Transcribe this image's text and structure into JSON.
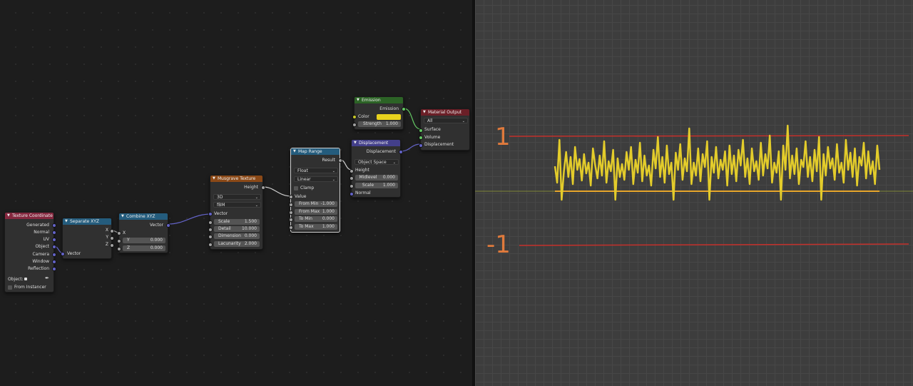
{
  "node_editor": {
    "nodes": {
      "texture_coordinate": {
        "title": "Texture Coordinate",
        "outputs": [
          "Generated",
          "Normal",
          "UV",
          "Object",
          "Camera",
          "Window",
          "Reflection"
        ],
        "object_label": "Object:",
        "from_instancer": "From Instancer"
      },
      "separate_xyz": {
        "title": "Separate XYZ",
        "outputs": [
          "X",
          "Y",
          "Z"
        ],
        "input": "Vector"
      },
      "combine_xyz": {
        "title": "Combine XYZ",
        "output": "Vector",
        "input_x": "X",
        "y_label": "Y",
        "y_value": "0.000",
        "z_label": "Z",
        "z_value": "0.000"
      },
      "musgrave": {
        "title": "Musgrave Texture",
        "output": "Height",
        "dimension_mode": "3D",
        "type": "fBM",
        "input_vector": "Vector",
        "fields": [
          {
            "label": "Scale",
            "value": "1.500"
          },
          {
            "label": "Detail",
            "value": "10.000"
          },
          {
            "label": "Dimension",
            "value": "0.000"
          },
          {
            "label": "Lacunarity",
            "value": "2.000"
          }
        ]
      },
      "map_range": {
        "title": "Map Range",
        "output": "Result",
        "data_type": "Float",
        "interpolation": "Linear",
        "clamp": "Clamp",
        "input_value": "Value",
        "fields": [
          {
            "label": "From Min",
            "value": "-1.000"
          },
          {
            "label": "From Max",
            "value": "1.000"
          },
          {
            "label": "To Min",
            "value": "0.000"
          },
          {
            "label": "To Max",
            "value": "1.000"
          }
        ]
      },
      "emission": {
        "title": "Emission",
        "output": "Emission",
        "color_label": "Color",
        "strength_label": "Strength",
        "strength_value": "1.000",
        "color": "#e8d21d"
      },
      "displacement": {
        "title": "Displacement",
        "output": "Displacement",
        "space": "Object Space",
        "input_height": "Height",
        "midlevel_label": "Midlevel",
        "midlevel_value": "0.000",
        "scale_label": "Scale",
        "scale_value": "1.000",
        "input_normal": "Normal"
      },
      "material_output": {
        "title": "Material Output",
        "target": "All",
        "inputs": [
          "Surface",
          "Volume",
          "Displacement"
        ]
      }
    }
  },
  "viewport": {
    "label_top": "1",
    "label_bottom": "-1",
    "colors": {
      "guide_line": "#c4302b",
      "signal": "#e3cc2b",
      "baseline": "#e7a52a",
      "label": "#e07a3c"
    },
    "signal_series": [
      0.35,
      0.12,
      0.72,
      0.05,
      0.28,
      0.55,
      0.2,
      0.48,
      0.1,
      0.62,
      0.3,
      0.45,
      0.15,
      0.52,
      0.25,
      0.4,
      0.08,
      0.6,
      0.36,
      0.18,
      0.5,
      0.22,
      0.7,
      0.12,
      0.42,
      0.28,
      0.58,
      0.04,
      0.46,
      0.2,
      0.38,
      0.16,
      0.55,
      0.3,
      0.62,
      0.1,
      0.44,
      0.26,
      0.68,
      0.14,
      0.5,
      0.22,
      0.36,
      0.08,
      0.58,
      0.32,
      0.76,
      0.2,
      0.48,
      0.12,
      0.64,
      0.24,
      0.4,
      0.06,
      0.54,
      0.3,
      0.66,
      0.16,
      0.46,
      0.28,
      0.88,
      0.1,
      0.4,
      0.22,
      0.6,
      0.14,
      0.52,
      0.34,
      0.7,
      0.04,
      0.48,
      0.26,
      0.62,
      0.18,
      0.44,
      0.3,
      0.56,
      0.08,
      0.64,
      0.24,
      0.5,
      0.14,
      0.58,
      0.36,
      0.72,
      0.2,
      0.46,
      0.1,
      0.6,
      0.28,
      0.42,
      0.16,
      0.68,
      0.22,
      0.52,
      0.32,
      0.78,
      0.12,
      0.4,
      0.26,
      0.56,
      0.06,
      0.64,
      0.3,
      0.92,
      0.18,
      0.5,
      0.24,
      0.6,
      0.1,
      0.44,
      0.34,
      0.7,
      0.2,
      0.48,
      0.14,
      0.58,
      0.28,
      0.76,
      0.04,
      0.52,
      0.22,
      0.62,
      0.32,
      0.46,
      0.16,
      0.66,
      0.26,
      0.4,
      0.12,
      0.72,
      0.3,
      0.54,
      0.2,
      0.6,
      0.08,
      0.48,
      0.36,
      0.68,
      0.18,
      0.56,
      0.24,
      0.42,
      0.1,
      0.64,
      0.3
    ]
  }
}
